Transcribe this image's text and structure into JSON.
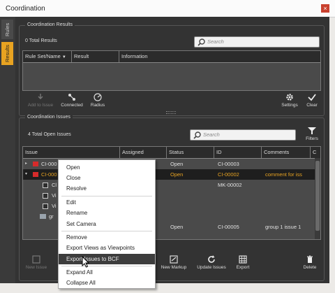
{
  "window": {
    "title": "Coordination",
    "close_glyph": "×"
  },
  "side_tabs": [
    {
      "label": "Rules",
      "active": false
    },
    {
      "label": "Results",
      "active": true
    }
  ],
  "results": {
    "section_title": "Coordination Results",
    "count_text": "0  Total Results",
    "search_placeholder": "Search",
    "columns": [
      "Rule Set/Name",
      "Result",
      "Information"
    ],
    "toolbar": {
      "add_to_issue": "Add to Issue",
      "connected": "Connected",
      "radius": "Radius",
      "settings": "Settings",
      "clear": "Clear"
    }
  },
  "issues": {
    "section_title": "Coordination Issues",
    "count_text": "4  Total Open Issues",
    "search_placeholder": "Search",
    "filters_label": "Filters",
    "columns": [
      "Issue",
      "Assigned",
      "Status",
      "ID",
      "Comments",
      "C"
    ],
    "rows": [
      {
        "issue": "CI-000",
        "status": "Open",
        "id": "CI-00003",
        "comments": "",
        "highlight": false
      },
      {
        "issue": "CI-000",
        "status": "Open",
        "id": "CI-00002",
        "comments": "comment for iss",
        "highlight": true
      },
      {
        "issue": "Cl",
        "status": "",
        "id": "MK-00002",
        "comments": "",
        "highlight": false
      },
      {
        "issue": "Vi",
        "status": "",
        "id": "",
        "comments": "",
        "highlight": false
      },
      {
        "issue": "Vi",
        "status": "",
        "id": "",
        "comments": "",
        "highlight": false
      },
      {
        "issue": "gr",
        "status": "",
        "id": "",
        "comments": "",
        "highlight": false
      },
      {
        "issue": "",
        "status": "Open",
        "id": "CI-00005",
        "comments": "group 1 issue 1",
        "highlight": false
      }
    ],
    "toolbar": {
      "new_issue": "New Issue",
      "new_markup": "New Markup",
      "update_issues": "Update Issues",
      "export": "Export",
      "delete": "Delete"
    }
  },
  "context_menu": {
    "items": [
      "Open",
      "Close",
      "Resolve",
      "Edit",
      "Rename",
      "Set Camera",
      "Remove",
      "Export Views as Viewpoints",
      "Export Issues to BCF",
      "Expand All",
      "Collapse All"
    ],
    "highlighted": "Export Issues to BCF"
  },
  "colors": {
    "accent": "#e8a321",
    "highlight_row": "#1e1e1e",
    "highlight_text": "#e8a321",
    "background": "#333333",
    "grid": "#4a4a4a"
  }
}
